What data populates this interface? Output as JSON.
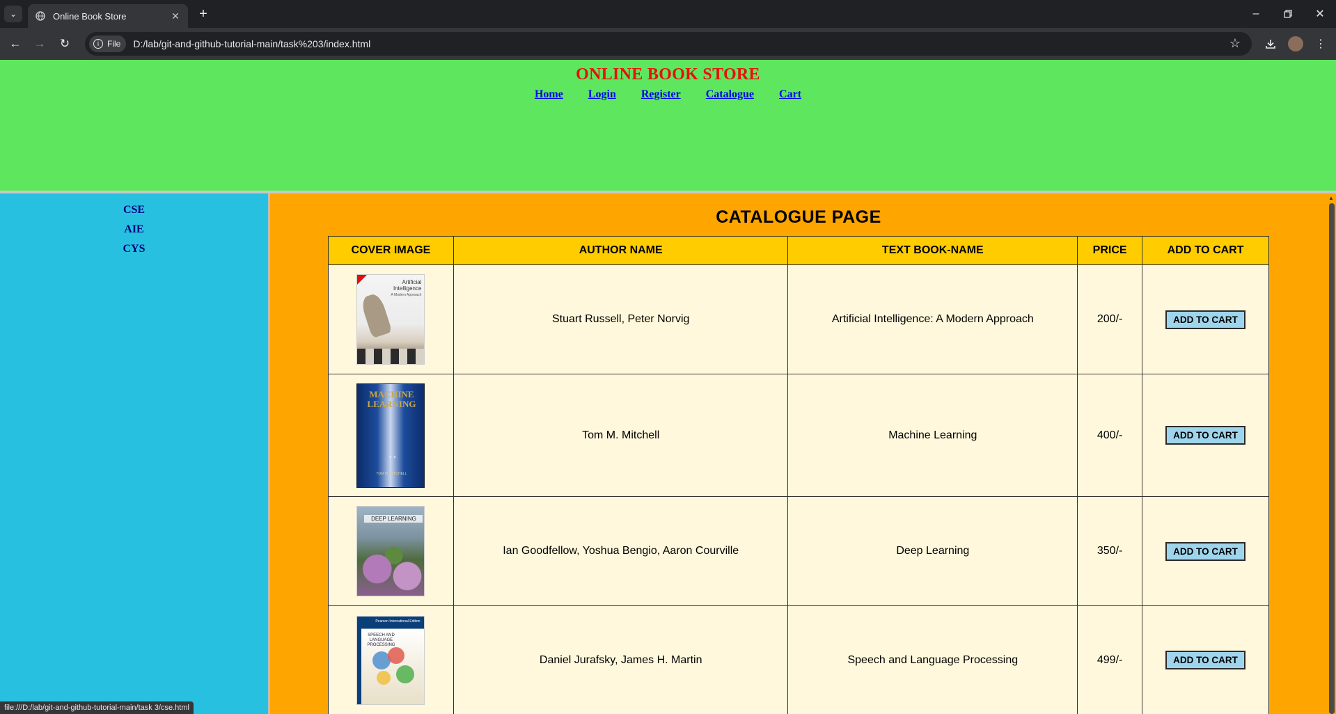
{
  "browser": {
    "tab_title": "Online Book Store",
    "file_chip": "File",
    "url": "D:/lab/git-and-github-tutorial-main/task%203/index.html",
    "status_url": "file:///D:/lab/git-and-github-tutorial-main/task 3/cse.html"
  },
  "header": {
    "title": "ONLINE BOOK STORE",
    "nav": [
      "Home",
      "Login",
      "Register",
      "Catalogue",
      "Cart"
    ]
  },
  "sidebar": {
    "items": [
      "CSE",
      "AIE",
      "CYS"
    ]
  },
  "main": {
    "heading": "CATALOGUE PAGE",
    "columns": [
      "COVER IMAGE",
      "AUTHOR NAME",
      "TEXT BOOK-NAME",
      "PRICE",
      "ADD TO CART"
    ],
    "rows": [
      {
        "cover_title": "Artificial Intelligence",
        "cover_subtitle": "A Modern Approach",
        "authors": "Stuart Russell, Peter Norvig",
        "book": "Artificial Intelligence: A Modern Approach",
        "price": "200/-",
        "button": "ADD TO CART"
      },
      {
        "cover_title": "MACHINE LEARNING",
        "cover_subtitle": "TOM M. MITCHELL",
        "authors": "Tom M. Mitchell",
        "book": "Machine Learning",
        "price": "400/-",
        "button": "ADD TO CART"
      },
      {
        "cover_title": "DEEP LEARNING",
        "cover_subtitle": "",
        "authors": "Ian Goodfellow, Yoshua Bengio, Aaron Courville",
        "book": "Deep Learning",
        "price": "350/-",
        "button": "ADD TO CART"
      },
      {
        "cover_title": "SPEECH AND LANGUAGE PROCESSING",
        "cover_subtitle": "Pearson International Edition",
        "authors": "Daniel Jurafsky, James H. Martin",
        "book": "Speech and Language Processing",
        "price": "499/-",
        "button": "ADD TO CART"
      }
    ]
  },
  "colors": {
    "header_bg": "#5ee75e",
    "title_red": "#e8100c",
    "sidebar_bg": "#28c0e0",
    "main_bg": "#ffa500",
    "table_header_bg": "#ffcc00",
    "cell_bg": "#fff8dc",
    "button_bg": "#9fd5ec"
  }
}
